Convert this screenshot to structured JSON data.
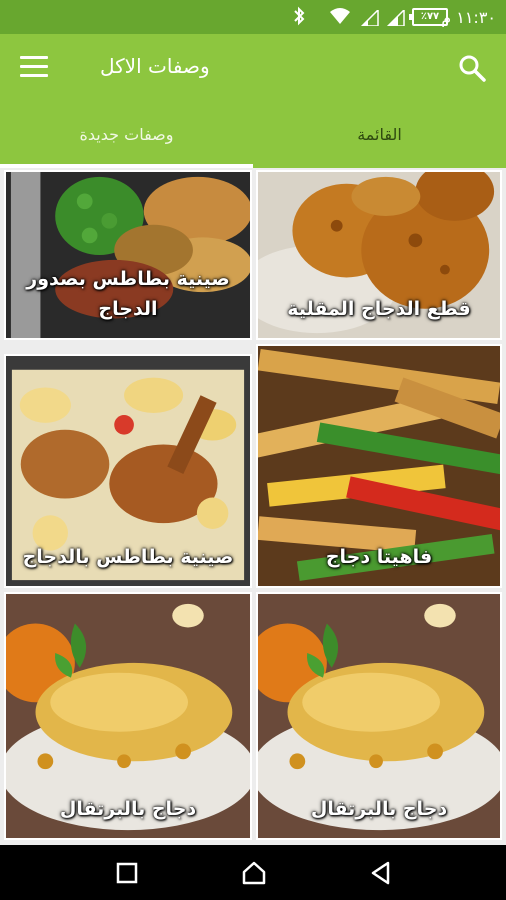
{
  "status_bar": {
    "time": "١١:٣٠ م",
    "battery": "٪٧٧",
    "icons": [
      "bluetooth-icon",
      "wifi-icon",
      "signal-icon",
      "signal-icon",
      "battery-icon"
    ]
  },
  "app_bar": {
    "title": "وصفات الاكل",
    "menu_icon": "hamburger-menu-icon",
    "search_icon": "search-icon",
    "background": "#8dc63f"
  },
  "tabs": [
    {
      "label": "وصفات جديدة",
      "selected": true
    },
    {
      "label": "القائمة",
      "selected": false
    }
  ],
  "recipes": [
    {
      "title": "قطع الدجاج المقلية"
    },
    {
      "title": "صينية بطاطس بصدور الدجاج"
    },
    {
      "title": "فاهيتا دجاج"
    },
    {
      "title": "صينية بطاطس بالدجاج"
    },
    {
      "title": "دجاج بالبرتقال"
    },
    {
      "title": "دجاج بالبرتقال"
    }
  ],
  "nav_bar": {
    "buttons": [
      "back-icon",
      "home-icon",
      "recents-icon"
    ]
  }
}
